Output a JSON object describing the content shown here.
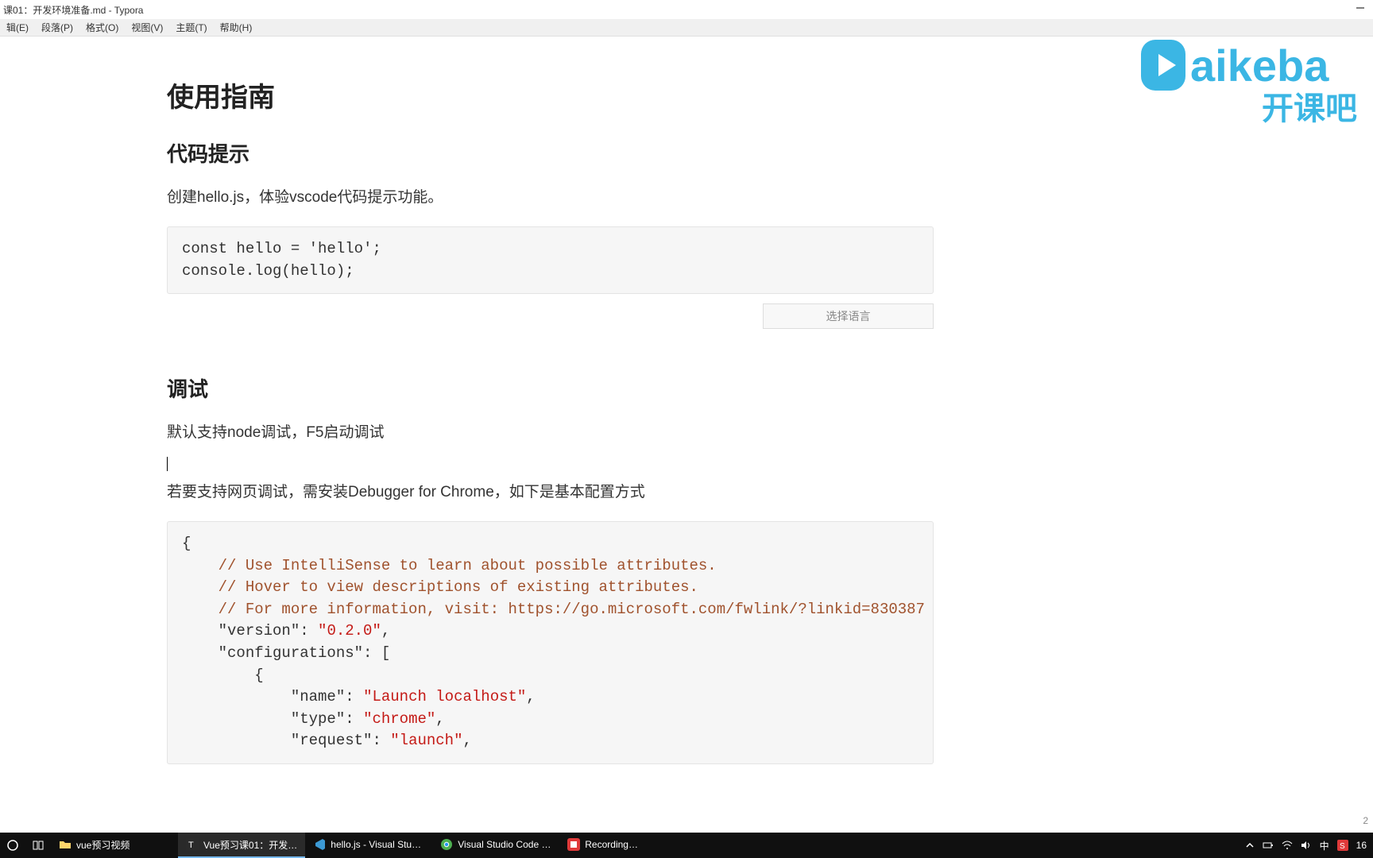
{
  "window": {
    "title": "课01：开发环境准备.md - Typora"
  },
  "menu": {
    "edit": "辑(E)",
    "para": "段落(P)",
    "format": "格式(O)",
    "view": "视图(V)",
    "theme": "主题(T)",
    "help": "帮助(H)"
  },
  "logo": {
    "brand_en": "Kaikeba",
    "brand_cn": "开课吧"
  },
  "doc": {
    "h1": "使用指南",
    "h2_code": "代码提示",
    "p_code_intro": "创建hello.js，体验vscode代码提示功能。",
    "code1_line1": "const hello = 'hello';",
    "code1_line2": "console.log(hello);",
    "lang_select": "选择语言",
    "h2_debug": "调试",
    "p_debug_1": "默认支持node调试，F5启动调试",
    "p_debug_2": "若要支持网页调试，需安装Debugger for Chrome，如下是基本配置方式",
    "json_open": "{",
    "json_c1": "// Use IntelliSense to learn about possible attributes.",
    "json_c2": "// Hover to view descriptions of existing attributes.",
    "json_c3": "// For more information, visit: https://go.microsoft.com/fwlink/?linkid=830387",
    "json_k_version": "\"version\"",
    "json_v_version": "\"0.2.0\"",
    "json_k_configs": "\"configurations\"",
    "json_arr_open": "[",
    "json_obj_open": "{",
    "json_k_name": "\"name\"",
    "json_v_name": "\"Launch localhost\"",
    "json_k_type": "\"type\"",
    "json_v_type": "\"chrome\"",
    "json_k_request": "\"request\"",
    "json_v_request": "\"launch\"",
    "colon": ": ",
    "comma": ","
  },
  "taskbar": {
    "app_folder": "vue预习视频",
    "app_typora": "Vue预习课01：开发…",
    "app_vscode": "hello.js - Visual Stu…",
    "app_chrome": "Visual Studio Code …",
    "app_recorder": "Recording…",
    "ime": "中",
    "clock": "16"
  },
  "page_indicator": "2"
}
